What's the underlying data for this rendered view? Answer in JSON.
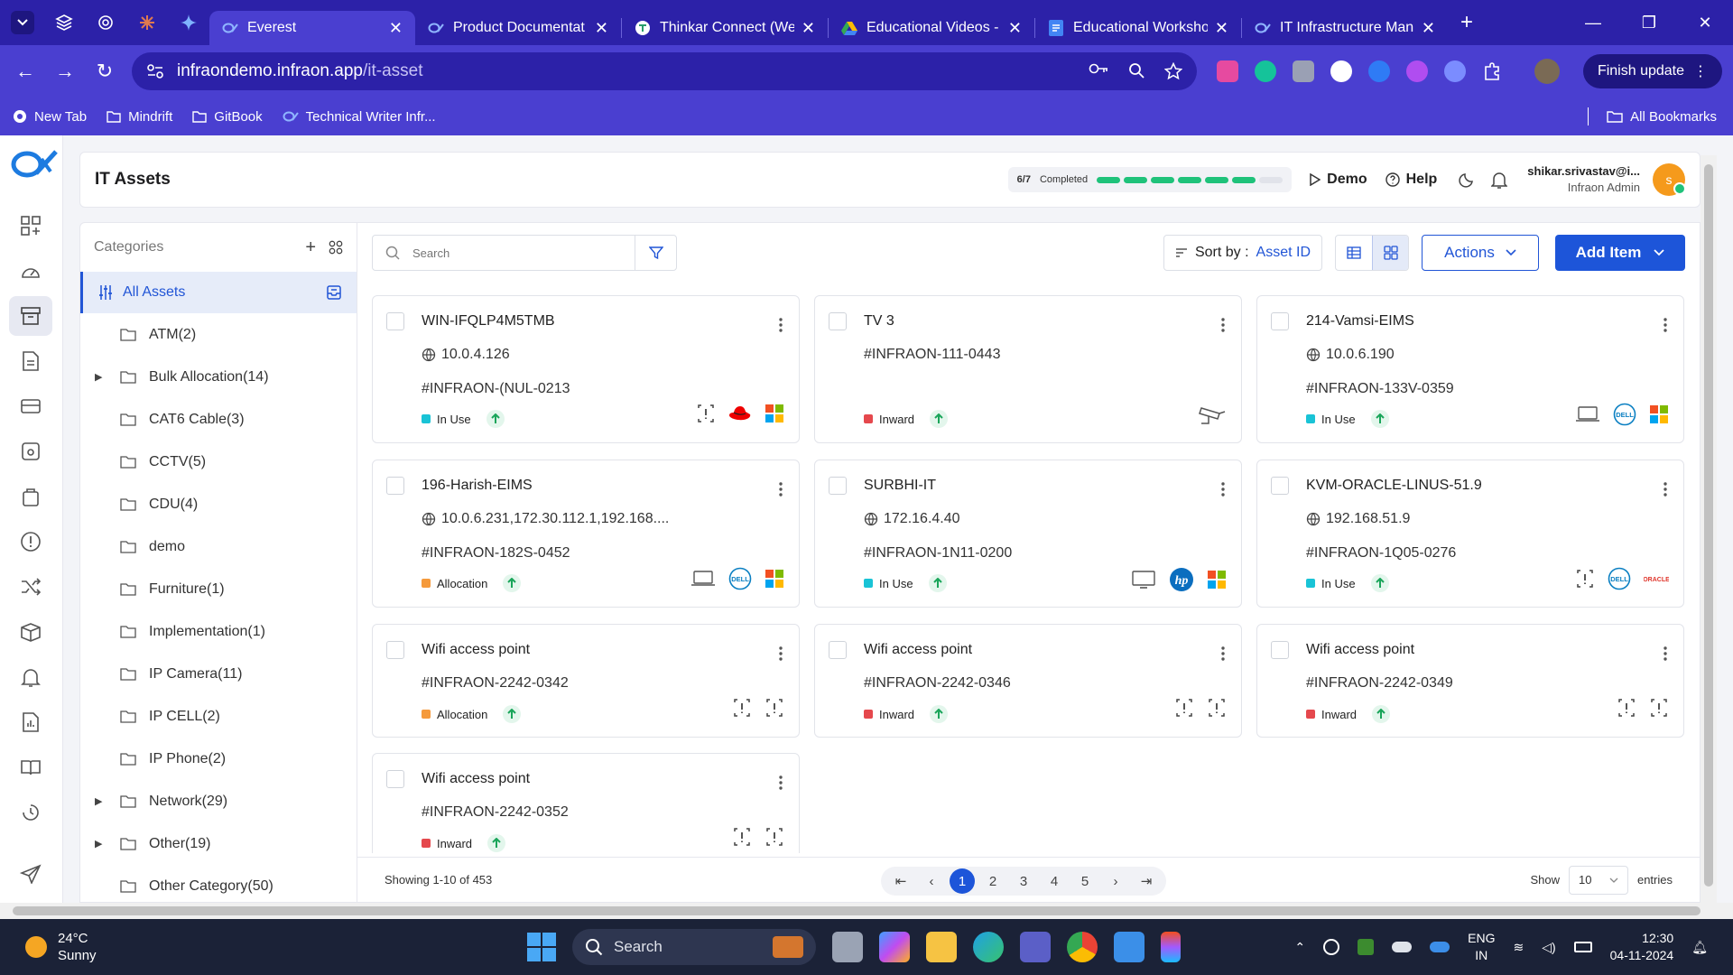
{
  "browser": {
    "tabs": [
      {
        "title": "Everest",
        "active": true
      },
      {
        "title": "Product Documentat"
      },
      {
        "title": "Thinkar Connect (We"
      },
      {
        "title": "Educational Videos -"
      },
      {
        "title": "Educational Worksho"
      },
      {
        "title": "IT Infrastructure Man"
      }
    ],
    "url_host": "infraondemo.infraon.app",
    "url_path": "/it-asset",
    "finish_update": "Finish update",
    "bookmarks": [
      "New Tab",
      "Mindrift",
      "GitBook",
      "Technical Writer Infr..."
    ],
    "all_bookmarks": "All Bookmarks"
  },
  "header": {
    "title": "IT Assets",
    "progress_fraction": "6/7",
    "progress_label": "Completed",
    "progress_done": 6,
    "progress_total": 7,
    "demo": "Demo",
    "help": "Help",
    "user_email": "shikar.srivastav@i...",
    "user_role": "Infraon Admin",
    "avatar": "s"
  },
  "categories": {
    "title": "Categories",
    "all": "All Assets",
    "items": [
      {
        "label": "ATM(2)",
        "expandable": false
      },
      {
        "label": "Bulk Allocation(14)",
        "expandable": true
      },
      {
        "label": "CAT6 Cable(3)",
        "expandable": false
      },
      {
        "label": "CCTV(5)",
        "expandable": false
      },
      {
        "label": "CDU(4)",
        "expandable": false
      },
      {
        "label": "demo",
        "expandable": false
      },
      {
        "label": "Furniture(1)",
        "expandable": false
      },
      {
        "label": "Implementation(1)",
        "expandable": false
      },
      {
        "label": "IP Camera(11)",
        "expandable": false
      },
      {
        "label": "IP CELL(2)",
        "expandable": false
      },
      {
        "label": "IP Phone(2)",
        "expandable": false
      },
      {
        "label": "Network(29)",
        "expandable": true
      },
      {
        "label": "Other(19)",
        "expandable": true
      },
      {
        "label": "Other Category(50)",
        "expandable": false
      }
    ]
  },
  "toolbar": {
    "search_placeholder": "Search",
    "sort_label": "Sort by :",
    "sort_value": "Asset ID",
    "actions": "Actions",
    "add_item": "Add Item"
  },
  "assets": [
    {
      "name": "WIN-IFQLP4M5TMB",
      "ip": "10.0.4.126",
      "id": "#INFRAON-(NUL-0213",
      "status": "In Use",
      "status_color": "#19c3d6",
      "icons": [
        "unknown-device-icon",
        "redhat-icon",
        "windows-icon"
      ]
    },
    {
      "name": "TV 3",
      "ip": "",
      "id": "#INFRAON-111-0443",
      "status": "Inward",
      "status_color": "#e5484d",
      "icons": [
        "cctv-camera-icon"
      ]
    },
    {
      "name": "214-Vamsi-EIMS",
      "ip": "10.0.6.190",
      "id": "#INFRAON-133V-0359",
      "status": "In Use",
      "status_color": "#19c3d6",
      "icons": [
        "laptop-icon",
        "dell-icon",
        "windows-icon"
      ]
    },
    {
      "name": "196-Harish-EIMS",
      "ip": "10.0.6.231,172.30.112.1,192.168....",
      "id": "#INFRAON-182S-0452",
      "status": "Allocation",
      "status_color": "#f59a3c",
      "icons": [
        "laptop-icon",
        "dell-icon",
        "windows-icon"
      ]
    },
    {
      "name": "SURBHI-IT",
      "ip": "172.16.4.40",
      "id": "#INFRAON-1N11-0200",
      "status": "In Use",
      "status_color": "#19c3d6",
      "icons": [
        "desktop-icon",
        "hp-icon",
        "windows-icon"
      ]
    },
    {
      "name": "KVM-ORACLE-LINUS-51.9",
      "ip": "192.168.51.9",
      "id": "#INFRAON-1Q05-0276",
      "status": "In Use",
      "status_color": "#19c3d6",
      "icons": [
        "unknown-device-icon",
        "dell-icon",
        "oracle-icon"
      ]
    },
    {
      "name": "Wifi access point",
      "ip": "",
      "id": "#INFRAON-2242-0342",
      "status": "Allocation",
      "status_color": "#f59a3c",
      "icons": [
        "unknown-device-icon",
        "unknown-device-icon"
      ]
    },
    {
      "name": "Wifi access point",
      "ip": "",
      "id": "#INFRAON-2242-0346",
      "status": "Inward",
      "status_color": "#e5484d",
      "icons": [
        "unknown-device-icon",
        "unknown-device-icon"
      ]
    },
    {
      "name": "Wifi access point",
      "ip": "",
      "id": "#INFRAON-2242-0349",
      "status": "Inward",
      "status_color": "#e5484d",
      "icons": [
        "unknown-device-icon",
        "unknown-device-icon"
      ]
    },
    {
      "name": "Wifi access point",
      "ip": "",
      "id": "#INFRAON-2242-0352",
      "status": "Inward",
      "status_color": "#e5484d",
      "icons": [
        "unknown-device-icon",
        "unknown-device-icon"
      ]
    }
  ],
  "footer": {
    "showing": "Showing 1-10 of 453",
    "pages": [
      "1",
      "2",
      "3",
      "4",
      "5"
    ],
    "current_page": "1",
    "show_label": "Show",
    "page_size": "10",
    "entries": "entries"
  },
  "taskbar": {
    "temp": "24°C",
    "weather": "Sunny",
    "search": "Search",
    "lang1": "ENG",
    "lang2": "IN",
    "time": "12:30",
    "date": "04-11-2024"
  }
}
